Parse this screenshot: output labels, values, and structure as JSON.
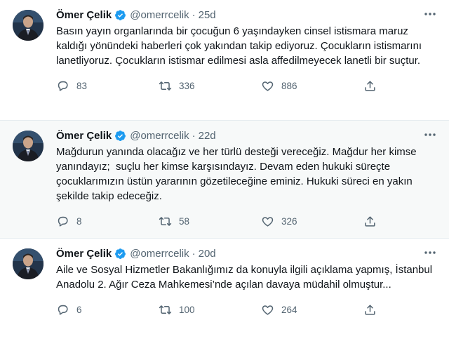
{
  "tweets": [
    {
      "name": "Ömer Çelik",
      "handle": "@omerrcelik",
      "separator": "·",
      "time": "25d",
      "text": "Basın yayın organlarında bir çocuğun 6 yaşındayken cinsel istismara maruz kaldığı yönündeki haberleri çok yakından takip ediyoruz. Çocukların istismarını lanetliyoruz. Çocukların istismar edilmesi asla affedilmeyecek lanetli bir suçtur.",
      "replies": "83",
      "retweets": "336",
      "likes": "886"
    },
    {
      "name": "Ömer Çelik",
      "handle": "@omerrcelik",
      "separator": "·",
      "time": "22d",
      "text": "Mağdurun yanında olacağız ve her türlü desteği vereceğiz. Mağdur her kimse yanındayız;  suçlu her kimse karşısındayız. Devam eden hukuki süreçte çocuklarımızın üstün yararının gözetileceğine eminiz. Hukuki süreci en yakın şekilde takip edeceğiz.",
      "replies": "8",
      "retweets": "58",
      "likes": "326"
    },
    {
      "name": "Ömer Çelik",
      "handle": "@omerrcelik",
      "separator": "·",
      "time": "20d",
      "text": "Aile ve Sosyal Hizmetler Bakanlığımız da konuyla ilgili açıklama yapmış, İstanbul Anadolu 2. Ağır Ceza Mahkemesi’nde açılan davaya müdahil olmuştur...",
      "replies": "6",
      "retweets": "100",
      "likes": "264"
    }
  ],
  "colors": {
    "verified": "#1d9bf0",
    "secondary_text": "#536471",
    "highlight_bg": "#f7f9f9"
  },
  "icons": {
    "verified": "verified-badge-icon",
    "more": "more-horizontal-icon",
    "reply": "reply-icon",
    "retweet": "retweet-icon",
    "like": "heart-icon",
    "share": "share-icon"
  }
}
